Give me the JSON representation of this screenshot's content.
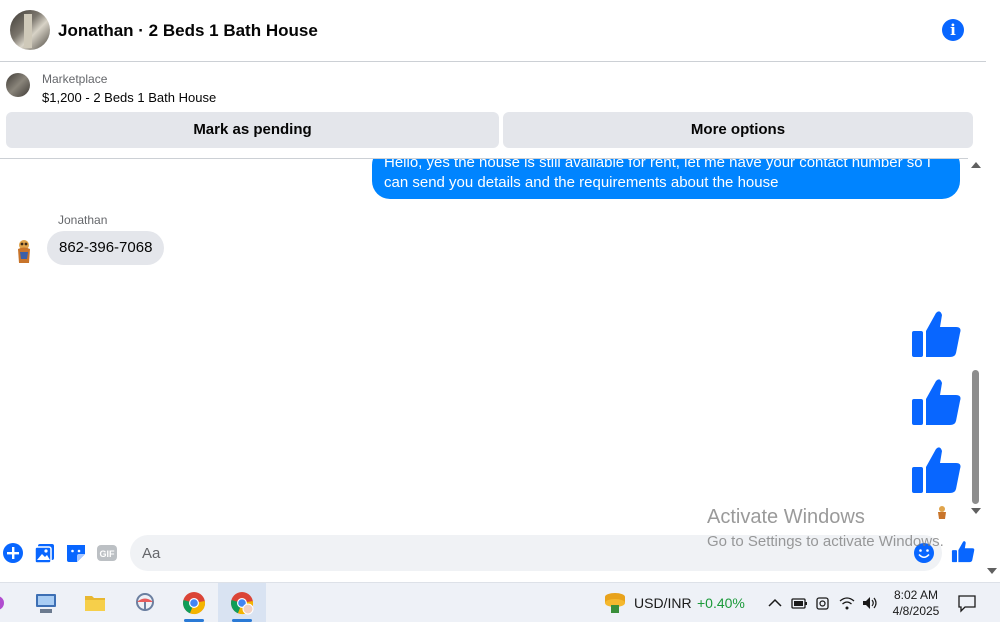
{
  "header": {
    "title": "Jonathan · 2 Beds 1 Bath House"
  },
  "marketplace": {
    "label": "Marketplace",
    "listing": "$1,200 - 2 Beds 1 Bath House",
    "buttons": {
      "mark_pending": "Mark as pending",
      "more_options": "More options"
    }
  },
  "conversation": {
    "outgoing_message": "Hello, yes the house is still available for rent, let me have your contact number so I can send you details and the requirements about the house",
    "incoming_sender": "Jonathan",
    "incoming_message": "862-396-7068",
    "likes_sent": 3
  },
  "composer": {
    "placeholder": "Aa",
    "icons": [
      "plus-icon",
      "photo-icon",
      "sticker-icon",
      "gif-icon",
      "emoji-icon",
      "thumbs-up-icon"
    ]
  },
  "watermark": {
    "line1": "Activate Windows",
    "line2": "Go to Settings to activate Windows."
  },
  "taskbar": {
    "apps": [
      "file-explorer-icon",
      "network-app-icon",
      "folder-icon",
      "app-icon",
      "chrome-icon",
      "chrome-profile-icon"
    ],
    "ticker": {
      "name": "USD/INR",
      "change": "+0.40%"
    },
    "clock": {
      "time": "8:02 AM",
      "date": "4/8/2025"
    }
  },
  "colors": {
    "messenger_blue": "#0084ff",
    "accent": "#0866ff",
    "ticker_positive": "#1b9a3a"
  }
}
